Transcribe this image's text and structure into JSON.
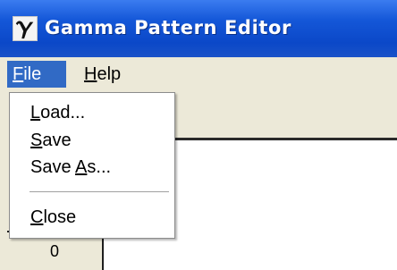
{
  "window": {
    "title": "Gamma Pattern Editor",
    "icon": "gamma-glyph-icon",
    "icon_glyph": "γ"
  },
  "menubar": {
    "file": {
      "pre": "",
      "u": "F",
      "post": "ile"
    },
    "help": {
      "pre": "",
      "u": "H",
      "post": "elp"
    }
  },
  "file_menu": {
    "load": {
      "pre": "",
      "u": "L",
      "post": "oad..."
    },
    "save": {
      "pre": "",
      "u": "S",
      "post": "ave"
    },
    "saveas": {
      "pre": "Save ",
      "u": "A",
      "post": "s..."
    },
    "close": {
      "pre": "",
      "u": "C",
      "post": "lose"
    }
  },
  "panel": {
    "cell_value": "0"
  },
  "colors": {
    "titlebar": "#0b48c8",
    "menu_highlight": "#316ac5",
    "chrome": "#ece9d8"
  }
}
